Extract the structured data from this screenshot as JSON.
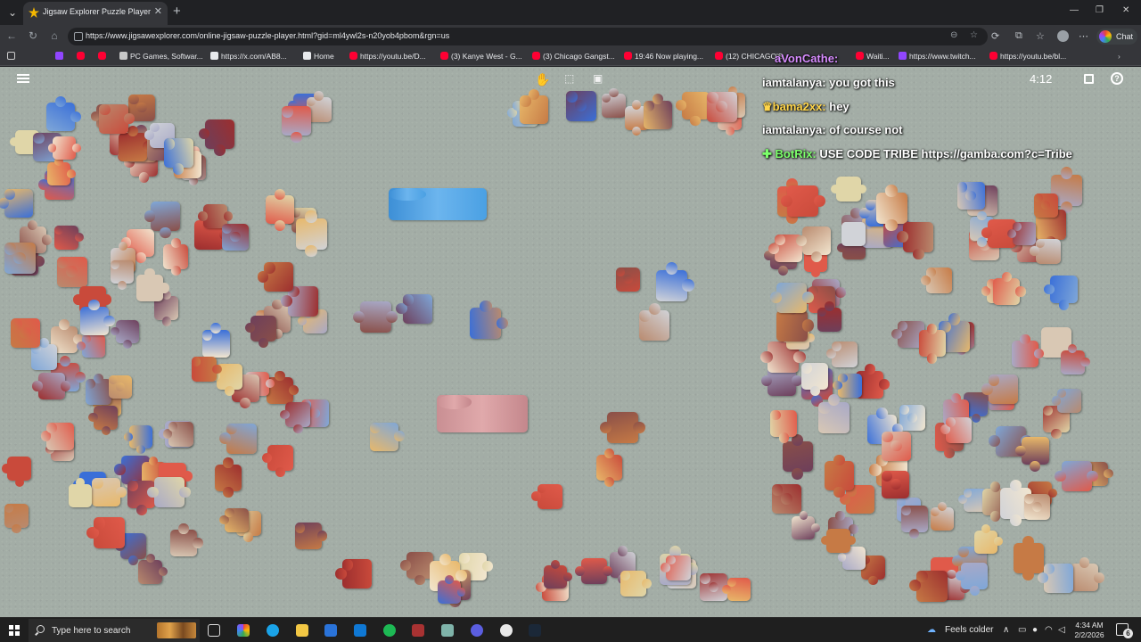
{
  "browser": {
    "tab_title": "Jigsaw Explorer Puzzle Player",
    "url": "https://www.jigsawexplorer.com/online-jigsaw-puzzle-player.html?gid=ml4ywl2s-n20yob4pbom&rgn=us",
    "chat_label": "Chat",
    "bookmarks": [
      {
        "label": "",
        "icon": "menu-icon"
      },
      {
        "label": "",
        "icon": "twitch-icon"
      },
      {
        "label": "",
        "icon": "youtube-icon"
      },
      {
        "label": "",
        "icon": "youtube-icon"
      },
      {
        "label": "PC Games, Softwar...",
        "icon": "steam-icon"
      },
      {
        "label": "https://x.com/AB8...",
        "icon": "x-icon"
      },
      {
        "label": "Home",
        "icon": "x-icon"
      },
      {
        "label": "https://youtu.be/D...",
        "icon": "youtube-icon"
      },
      {
        "label": "(3) Kanye West - G...",
        "icon": "youtube-icon"
      },
      {
        "label": "(3) Chicago Gangst...",
        "icon": "youtube-icon"
      },
      {
        "label": "19:46 Now playing...",
        "icon": "youtube-icon"
      },
      {
        "label": "(12) CHICAGO'S",
        "icon": "youtube-icon"
      },
      {
        "label": "Waiti...",
        "icon": "youtube-icon"
      },
      {
        "label": "https://www.twitch...",
        "icon": "twitch-icon"
      },
      {
        "label": "https://youtu.be/bl...",
        "icon": "youtube-icon"
      }
    ]
  },
  "game": {
    "timer": "4:12",
    "toolbar_icons": [
      "hand-icon",
      "box-select-icon",
      "image-preview-icon"
    ]
  },
  "stream_chat": [
    {
      "user": "aVonCathe:",
      "message": "",
      "color": "#d78cff"
    },
    {
      "user": "iamtalanya:",
      "message": "you got this",
      "color": "#ffffff"
    },
    {
      "user": "bama2xx:",
      "message": "hey",
      "color": "#ffd54a"
    },
    {
      "user": "iamtalanya:",
      "message": "of course not",
      "color": "#ffffff"
    },
    {
      "user": "BotRix:",
      "message": "USE CODE TRIBE https://gamba.com?c=Tribe",
      "color": "#7cff6b"
    }
  ],
  "taskbar": {
    "search_placeholder": "Type here to search",
    "weather": "Feels colder",
    "time": "4:34 AM",
    "date": "2/2/2026",
    "notification_count": "6"
  }
}
